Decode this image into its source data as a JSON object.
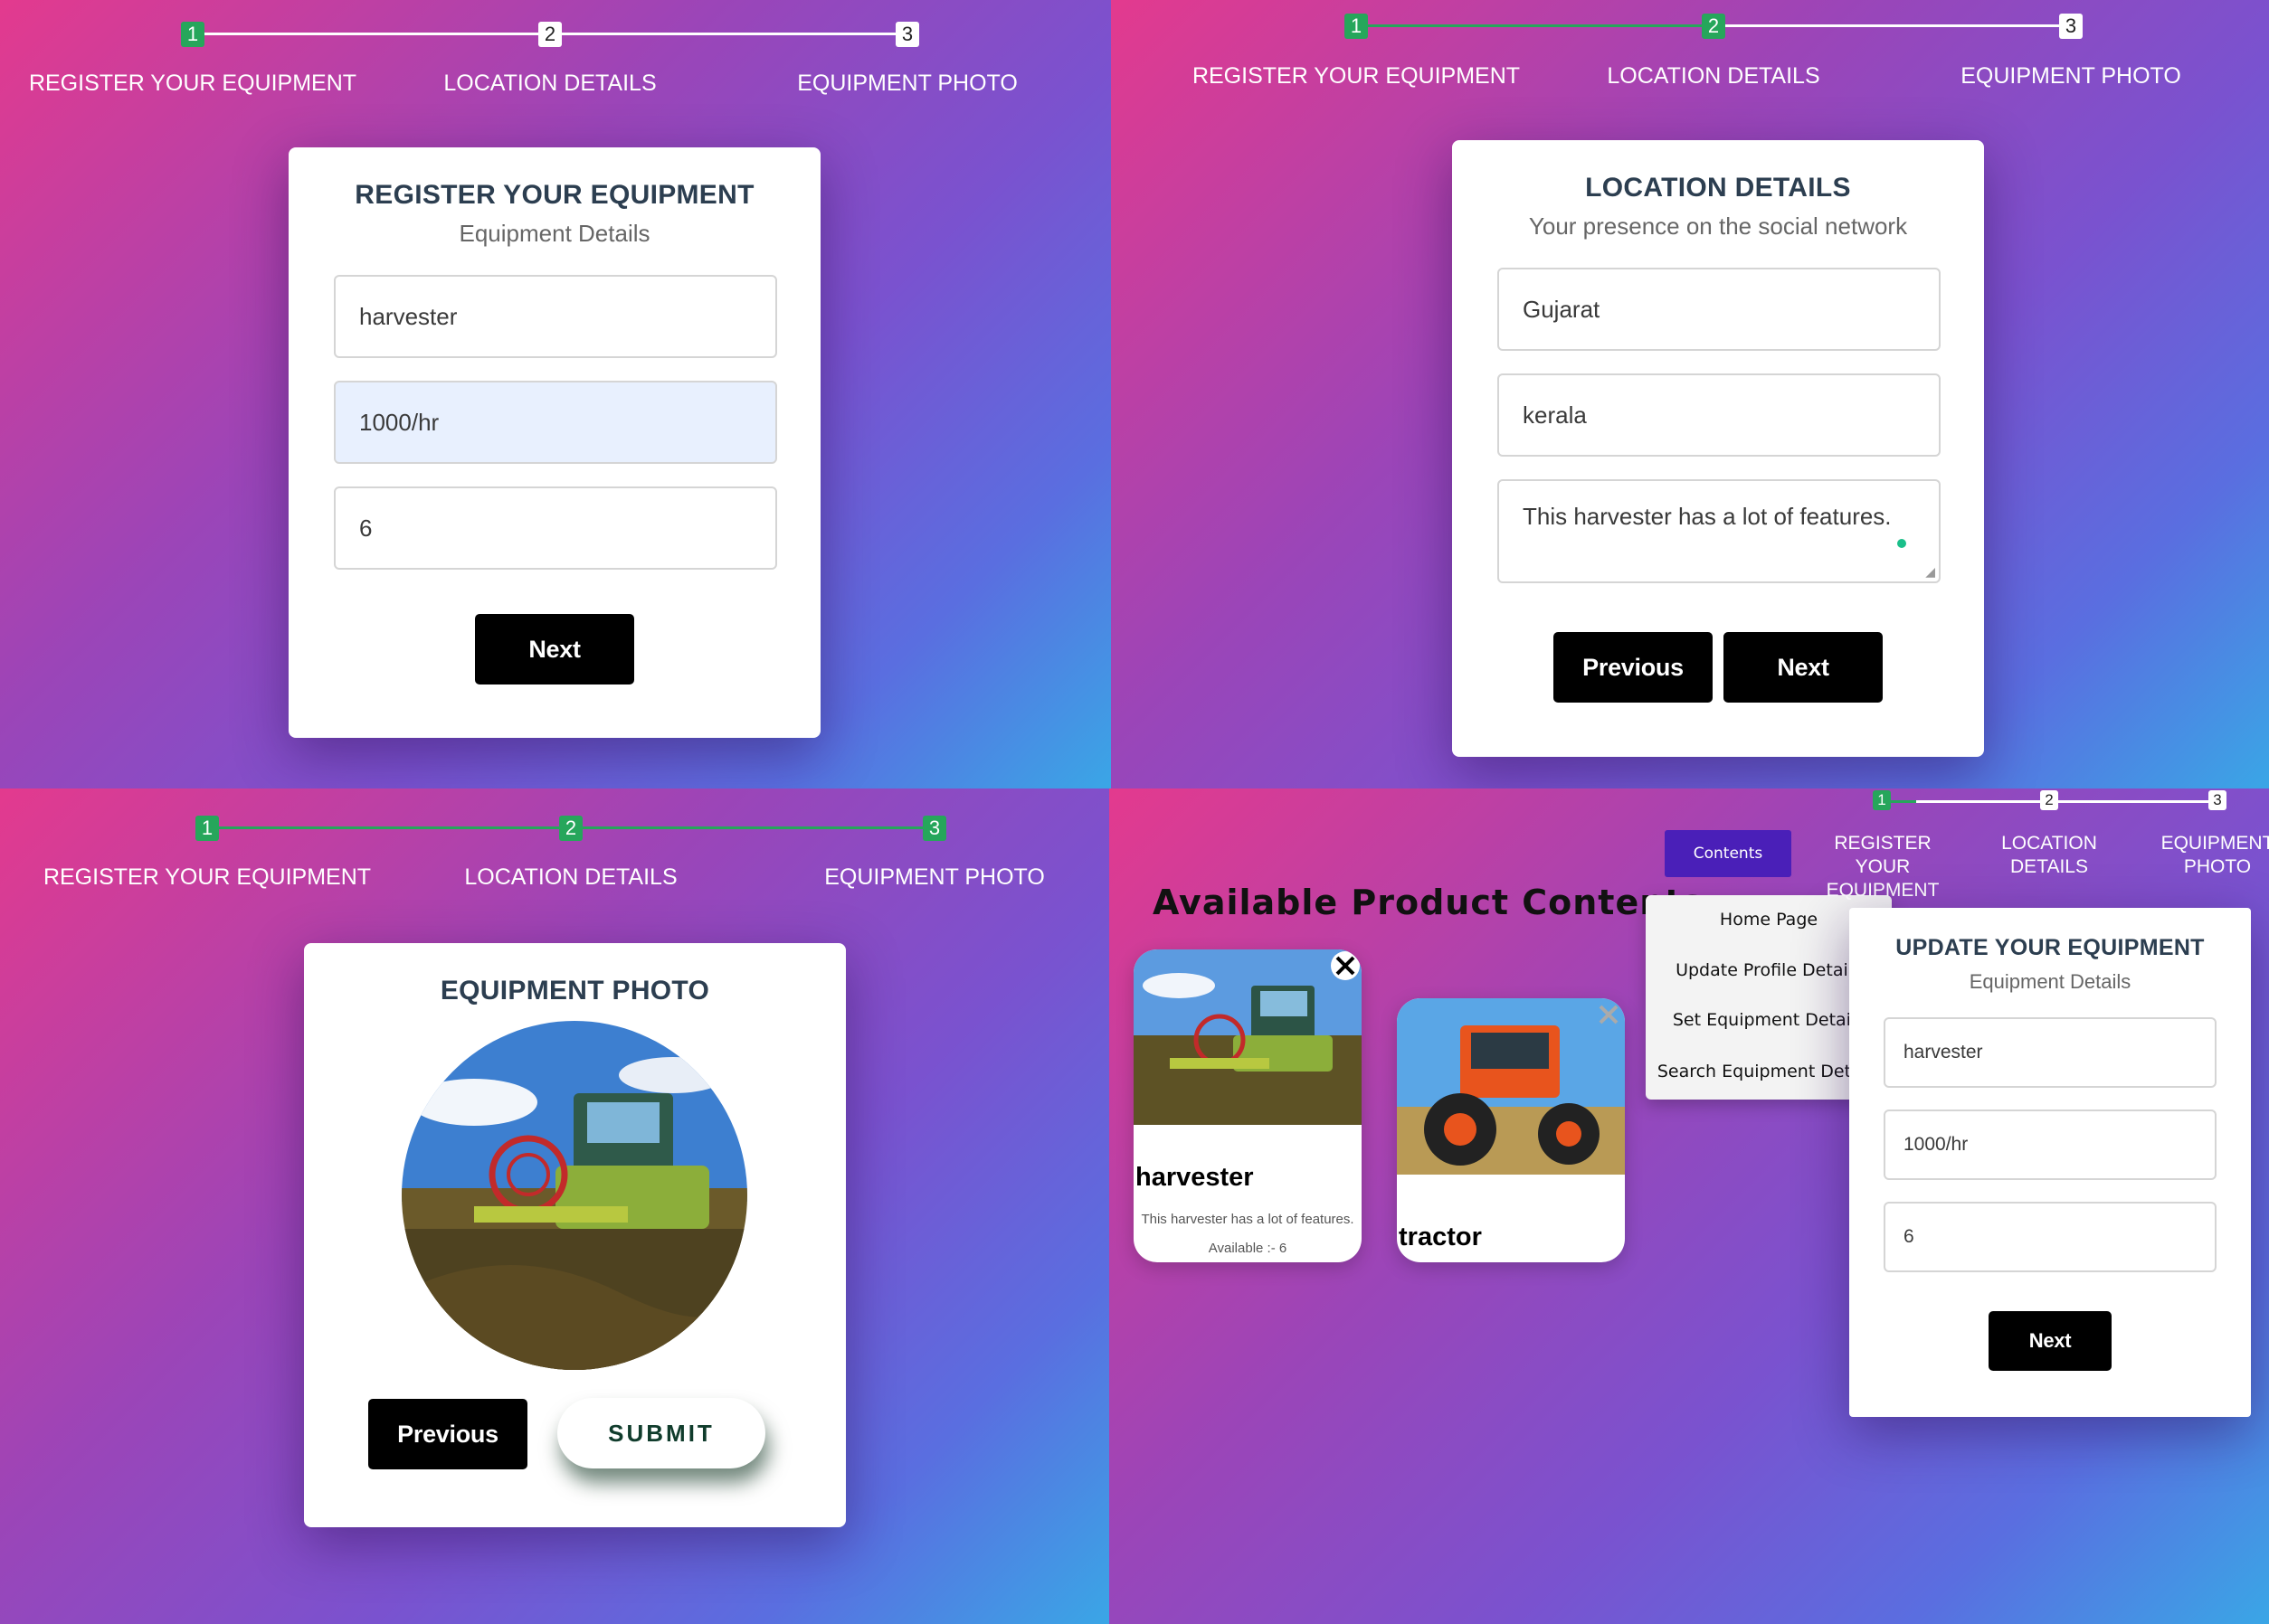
{
  "steps": {
    "step1_label": "REGISTER YOUR EQUIPMENT",
    "step2_label": "LOCATION DETAILS",
    "step3_label": "EQUIPMENT PHOTO",
    "n1": "1",
    "n2": "2",
    "n3": "3"
  },
  "step1_form": {
    "title": "REGISTER YOUR EQUIPMENT",
    "subtitle": "Equipment Details",
    "name_value": "harvester",
    "rate_value": "1000/hr",
    "qty_value": "6",
    "next_label": "Next"
  },
  "step2_form": {
    "title": "LOCATION DETAILS",
    "subtitle": "Your presence on the social network",
    "state_value": "Gujarat",
    "city_value": "kerala",
    "desc_value": "This harvester has a lot of features.",
    "prev_label": "Previous",
    "next_label": "Next"
  },
  "step3_form": {
    "title": "EQUIPMENT PHOTO",
    "prev_label": "Previous",
    "submit_label": "SUBMIT"
  },
  "catalog": {
    "heading": "Available Product Contents",
    "contents_button": "Contents",
    "menu": [
      "Home Page",
      "Update Profile Details",
      "Set Equipment Details",
      "Search Equipment Details"
    ],
    "steps": {
      "step1_line1": "REGISTER YOUR",
      "step1_line2": "EQUIPMENT",
      "step2": "LOCATION DETAILS",
      "step3_line1": "EQUIPMENT",
      "step3_line2": "PHOTO"
    },
    "products": [
      {
        "name": "harvester",
        "description": "This harvester has a lot of features.",
        "availability": "Available :- 6"
      },
      {
        "name": "tractor"
      }
    ],
    "update_form": {
      "title": "UPDATE YOUR EQUIPMENT",
      "subtitle": "Equipment Details",
      "name_value": "harvester",
      "rate_value": "1000/hr",
      "qty_value": "6",
      "next_label": "Next"
    }
  },
  "colors": {
    "progress_done": "#26a65b",
    "contents_button": "#4a1fb8",
    "gradient": [
      "#e33a8e",
      "#9b45b8",
      "#5a6ee0",
      "#3aa6e6"
    ]
  }
}
